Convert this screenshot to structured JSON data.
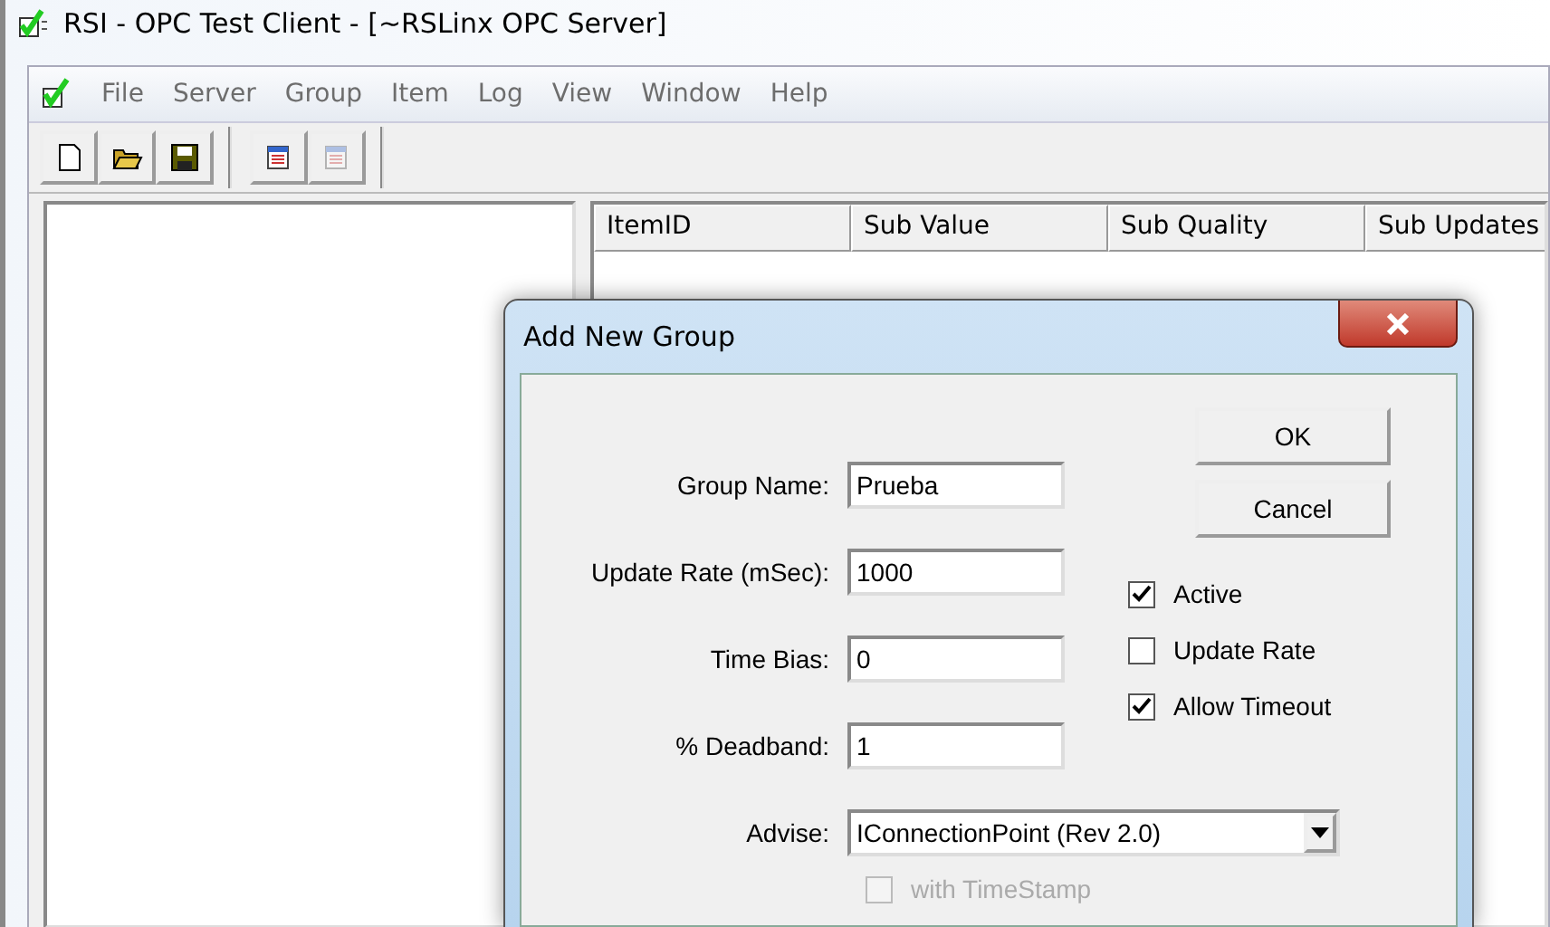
{
  "window": {
    "title": "RSI - OPC Test Client - [~RSLinx OPC Server]"
  },
  "menu": [
    "File",
    "Server",
    "Group",
    "Item",
    "Log",
    "View",
    "Window",
    "Help"
  ],
  "toolbar": [
    {
      "kind": "new",
      "disabled": false
    },
    {
      "kind": "open",
      "disabled": false
    },
    {
      "kind": "save",
      "disabled": false
    },
    {
      "kind": "gap"
    },
    {
      "kind": "grid",
      "disabled": false
    },
    {
      "kind": "grid",
      "disabled": true
    }
  ],
  "table": {
    "columns": [
      "ItemID",
      "Sub Value",
      "Sub Quality",
      "Sub Updates"
    ]
  },
  "dialog": {
    "title": "Add New Group",
    "fields": [
      {
        "label": "Group Name:",
        "value": "Prueba"
      },
      {
        "label": "Update Rate (mSec):",
        "value": "1000"
      },
      {
        "label": "Time Bias:",
        "value": "0"
      },
      {
        "label": "% Deadband:",
        "value": "1"
      }
    ],
    "buttons": [
      "OK",
      "Cancel"
    ],
    "checkboxes": [
      {
        "label": "Active",
        "checked": true,
        "disabled": false
      },
      {
        "label": "Update Rate",
        "checked": false,
        "disabled": false
      },
      {
        "label": "Allow Timeout",
        "checked": true,
        "disabled": false
      }
    ],
    "advise": {
      "label": "Advise:",
      "value": "IConnectionPoint (Rev 2.0)"
    },
    "timestamp": {
      "label": "with TimeStamp",
      "checked": false,
      "disabled": true
    }
  }
}
